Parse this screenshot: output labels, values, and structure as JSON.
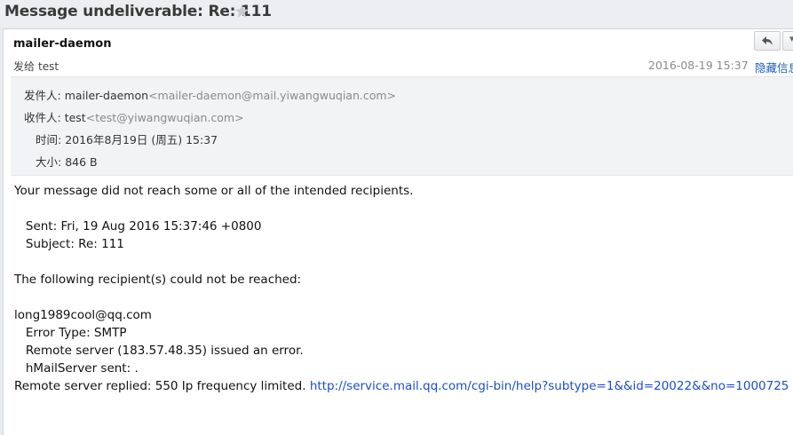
{
  "header": {
    "subject": "Message undeliverable: Re: 111",
    "star_icon": "star-icon"
  },
  "message": {
    "from_name": "mailer-daemon",
    "to_label": "发给",
    "to_name": "test",
    "date": "2016-08-19 15:37",
    "hide_details": "隐藏信息"
  },
  "toolbar": {
    "reply_icon": "reply-icon",
    "more_icon": "chevron-down-icon"
  },
  "details": {
    "sender_label": "发件人:",
    "sender_name": "mailer-daemon",
    "sender_address": "<mailer-daemon@mail.yiwangwuqian.com>",
    "recipient_label": "收件人:",
    "recipient_name": "test",
    "recipient_address": "<test@yiwangwuqian.com>",
    "time_label": "时间:",
    "time_value": "2016年8月19日 (周五) 15:37",
    "size_label": "大小:",
    "size_value": "846 B"
  },
  "body": {
    "line1": "Your message did not reach some or all of the intended recipients.",
    "sent": "   Sent: Fri, 19 Aug 2016 15:37:46 +0800",
    "subject": "   Subject: Re: 111",
    "line2": "The following recipient(s) could not be reached:",
    "recipient": "long1989cool@qq.com",
    "error_type": "   Error Type: SMTP",
    "remote_error": "   Remote server (183.57.48.35) issued an error.",
    "hmail": "   hMailServer sent: .",
    "replied": "Remote server replied: 550 Ip frequency limited. ",
    "link": "http://service.mail.qq.com/cgi-bin/help?subtype=1&&id=20022&&no=1000725"
  }
}
